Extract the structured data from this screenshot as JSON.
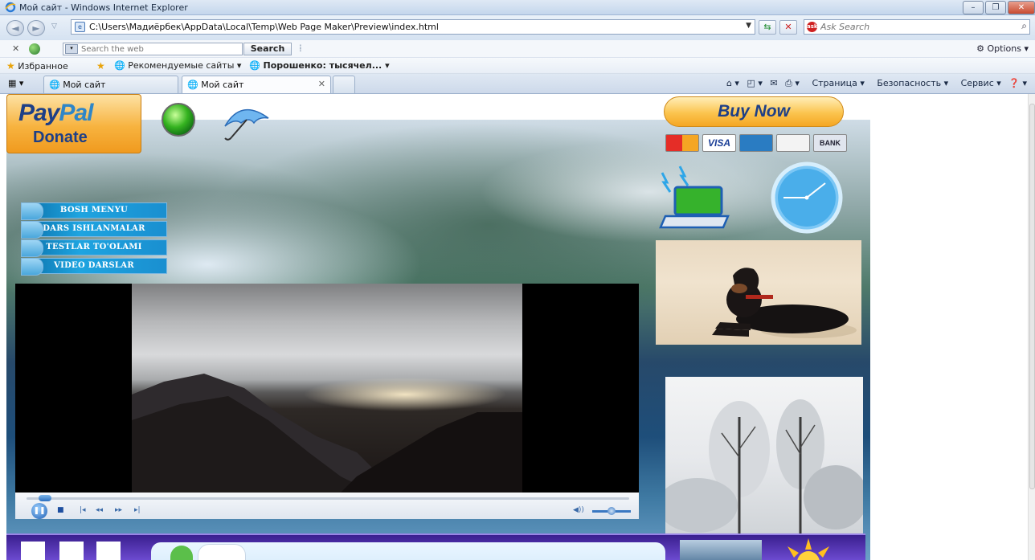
{
  "window": {
    "title": "Мой сайт - Windows Internet Explorer"
  },
  "address_bar": {
    "url": "C:\\Users\\Мадиёрбек\\AppData\\Local\\Temp\\Web Page Maker\\Preview\\index.html",
    "search_placeholder": "Ask Search"
  },
  "search_toolbar": {
    "placeholder": "Search the web",
    "button": "Search",
    "options": "Options"
  },
  "favorites_bar": {
    "favorites": "Избранное",
    "recommended": "Рекомендуемые сайты",
    "poroshenko": "Порошенко: тысячел..."
  },
  "tabs": [
    {
      "label": "Мой сайт"
    },
    {
      "label": "Мой сайт"
    }
  ],
  "command_bar": {
    "page": "Страница",
    "safety": "Безопасность",
    "tools": "Сервис"
  },
  "site": {
    "paypal_brand": "PayPal",
    "paypal_action": "Donate",
    "buy_now": "Buy Now",
    "cards": [
      "VISA",
      "BANK"
    ],
    "menu": [
      "BOSH MENYU",
      "DARS ISHLANMALAR",
      "TESTLAR TO'OLAMI",
      "VIDEO DARSLAR"
    ]
  },
  "colors": {
    "menu_blue": "#1ea4e0",
    "paypal_orange": "#f7b33f",
    "footer_purple": "#4b2fae"
  },
  "player": {
    "progress": 0.02,
    "volume": 0.5
  }
}
